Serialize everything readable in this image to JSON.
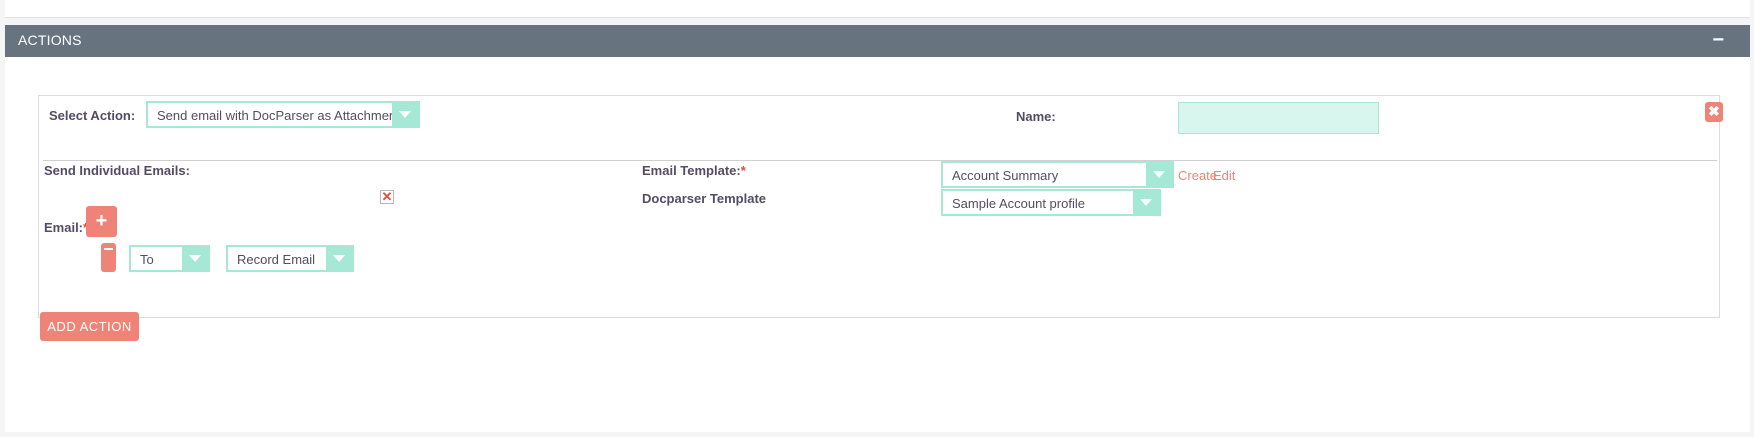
{
  "panel": {
    "title": "ACTIONS",
    "collapse_symbol": "−"
  },
  "action": {
    "select_action_label": "Select Action:",
    "select_action_value": "Send email with DocParser as Attachment",
    "name_label": "Name:",
    "name_value": "",
    "remove_symbol": "✖",
    "send_individual_label": "Send Individual Emails:",
    "send_individual_checked": true,
    "send_individual_mark": "✕",
    "email_template_label": "Email Template:",
    "email_template_value": "Account Summary",
    "create_link": "Create",
    "edit_link": "Edit",
    "docparser_template_label": "Docparser Template",
    "docparser_template_value": "Sample Account profile",
    "email_label": "Email:",
    "required_marker": "*",
    "add_email_symbol": "+",
    "recipient_type_value": "To",
    "recipient_source_value": "Record Email"
  },
  "footer": {
    "add_action_label": "ADD ACTION"
  },
  "colors": {
    "header_bg": "#677480",
    "accent_coral": "#f08377",
    "select_border": "#a5e8d6",
    "required_red": "#e5493a"
  },
  "icons": {
    "collapse": "minus-icon",
    "remove_action": "close-icon",
    "dropdown": "chevron-down-icon",
    "add_email": "plus-icon",
    "remove_email": "minus-icon",
    "checkbox_mark": "x-mark-icon"
  }
}
